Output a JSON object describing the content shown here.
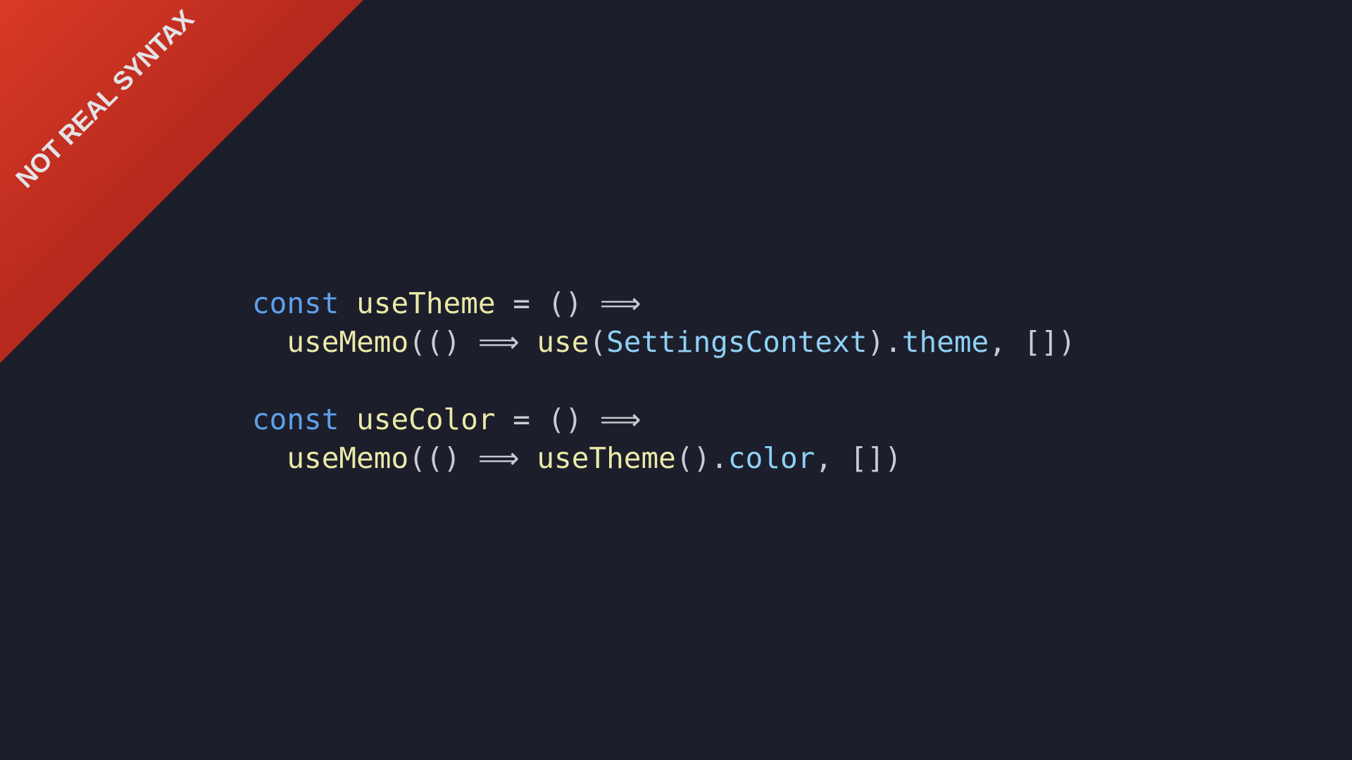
{
  "banner": {
    "label": "NOT REAL SYNTAX"
  },
  "code": {
    "lines": [
      [
        {
          "text": "const",
          "kind": "kw"
        },
        {
          "text": " ",
          "kind": "punc"
        },
        {
          "text": "useTheme",
          "kind": "fn"
        },
        {
          "text": " = () ⟹",
          "kind": "punc"
        }
      ],
      [
        {
          "text": "  ",
          "kind": "punc"
        },
        {
          "text": "useMemo",
          "kind": "fn"
        },
        {
          "text": "(() ⟹ ",
          "kind": "punc"
        },
        {
          "text": "use",
          "kind": "fn"
        },
        {
          "text": "(",
          "kind": "punc"
        },
        {
          "text": "SettingsContext",
          "kind": "prop"
        },
        {
          "text": ").",
          "kind": "punc"
        },
        {
          "text": "theme",
          "kind": "prop"
        },
        {
          "text": ", [])",
          "kind": "punc"
        }
      ],
      [],
      [
        {
          "text": "const",
          "kind": "kw"
        },
        {
          "text": " ",
          "kind": "punc"
        },
        {
          "text": "useColor",
          "kind": "fn"
        },
        {
          "text": " = () ⟹",
          "kind": "punc"
        }
      ],
      [
        {
          "text": "  ",
          "kind": "punc"
        },
        {
          "text": "useMemo",
          "kind": "fn"
        },
        {
          "text": "(() ⟹ ",
          "kind": "punc"
        },
        {
          "text": "useTheme",
          "kind": "fn"
        },
        {
          "text": "().",
          "kind": "punc"
        },
        {
          "text": "color",
          "kind": "prop"
        },
        {
          "text": ", [])",
          "kind": "punc"
        }
      ]
    ]
  },
  "colors": {
    "background": "#1c1f2b",
    "banner": "#c0301f",
    "keyword": "#5fa0ec",
    "function": "#ece9a8",
    "property": "#8fd0f6",
    "punctuation": "#c9ccd3"
  }
}
